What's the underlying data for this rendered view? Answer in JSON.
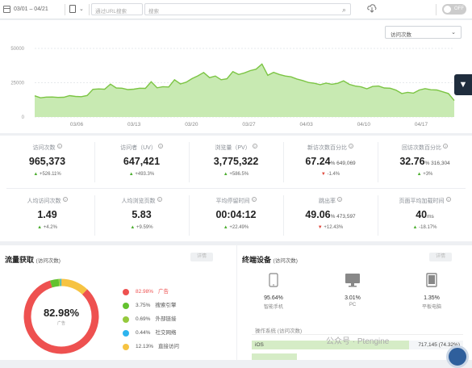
{
  "toolbar": {
    "date_range": "03/01 – 04/21",
    "url_placeholder": "通过URL搜索",
    "search_placeholder": "搜索",
    "toggle_label": "OFF"
  },
  "chart": {
    "metric_select": "访问次数"
  },
  "chart_data": {
    "type": "area",
    "x_tick_labels": [
      "03/06",
      "03/13",
      "03/20",
      "03/27",
      "04/03",
      "04/10",
      "04/17"
    ],
    "y_tick_labels": [
      "50000",
      "25000",
      "0"
    ],
    "ylim": [
      0,
      50000
    ],
    "color": "#7cc544",
    "fill": "#c8eab2",
    "series": [
      {
        "values": [
          15500,
          14000,
          14500,
          14600,
          14300,
          14400,
          15600,
          15000,
          14800,
          15700,
          20200,
          20500,
          20300,
          24000,
          21200,
          21000,
          20000,
          20300,
          21000,
          20900,
          25700,
          21300,
          22100,
          21900,
          27200,
          24100,
          25400,
          28000,
          30000,
          32500,
          28700,
          29900,
          27200,
          27900,
          33100,
          31000,
          32200,
          33800,
          34900,
          38600,
          30400,
          32600,
          31000,
          29900,
          29300,
          27700,
          26600,
          25200,
          24600,
          23600,
          24700,
          23900,
          24600,
          26400,
          23800,
          22600,
          22000,
          20600,
          22300,
          22600,
          21200,
          21000,
          19600,
          17100,
          18000,
          17400,
          19700,
          20700,
          19900,
          19700,
          18400,
          17100,
          12000
        ]
      }
    ]
  },
  "stats": [
    {
      "label": "访问次数",
      "value": "965,373",
      "extra": "",
      "dir": "up",
      "change": "+526.11%"
    },
    {
      "label": "访问者（UV）",
      "value": "647,421",
      "extra": "",
      "dir": "up",
      "change": "+493.3%"
    },
    {
      "label": "浏览量（PV）",
      "value": "3,775,322",
      "extra": "",
      "dir": "up",
      "change": "+586.5%"
    },
    {
      "label": "新访次数百分比",
      "value": "67.24",
      "extra": "% 649,069",
      "dir": "dn",
      "change": "-1.4%"
    },
    {
      "label": "回访次数百分比",
      "value": "32.76",
      "extra": "% 316,304",
      "dir": "up",
      "change": "+3%"
    },
    {
      "label": "人均访问次数",
      "value": "1.49",
      "extra": "",
      "dir": "up",
      "change": "+4.2%"
    },
    {
      "label": "人均浏览页数",
      "value": "5.83",
      "extra": "",
      "dir": "up",
      "change": "+9.59%"
    },
    {
      "label": "平均停留时间",
      "value": "00:04:12",
      "extra": "",
      "dir": "up",
      "change": "+22.49%"
    },
    {
      "label": "跳出率",
      "value": "49.06",
      "extra": "% 473,597",
      "dir": "dn",
      "change": "+12.43%"
    },
    {
      "label": "页面平均加载时间",
      "value": "40",
      "extra": "ms",
      "dir": "up",
      "change": "-18.17%"
    }
  ],
  "traffic": {
    "title": "流量获取",
    "subtitle": "(访问次数)",
    "button": "详情",
    "center_value": "82.98%",
    "center_label": "广告",
    "items": [
      {
        "pct": "82.98%",
        "name": "广告",
        "color": "#ee5150",
        "value": 82.98
      },
      {
        "pct": "3.75%",
        "name": "搜索引擎",
        "color": "#63c22f",
        "value": 3.75
      },
      {
        "pct": "0.69%",
        "name": "外部链接",
        "color": "#95c93d",
        "value": 0.69
      },
      {
        "pct": "0.44%",
        "name": "社交网络",
        "color": "#2eb4ee",
        "value": 0.44
      },
      {
        "pct": "12.13%",
        "name": "直接访问",
        "color": "#f6c342",
        "value": 12.13
      }
    ]
  },
  "devices": {
    "title": "终端设备",
    "subtitle": "(访问次数)",
    "button": "详情",
    "items": [
      {
        "pct": "95.64%",
        "name": "智能手机",
        "icon": "phone-icon"
      },
      {
        "pct": "3.01%",
        "name": "PC",
        "icon": "desktop-icon"
      },
      {
        "pct": "1.35%",
        "name": "平板电脑",
        "icon": "tablet-icon"
      }
    ],
    "os_title": "操作系统 (访问次数)",
    "os_rows": [
      {
        "name": "iOS",
        "value": "717,145 (74.32%)",
        "share": 0.7432
      }
    ]
  },
  "watermark": "公众号 · Ptengine"
}
